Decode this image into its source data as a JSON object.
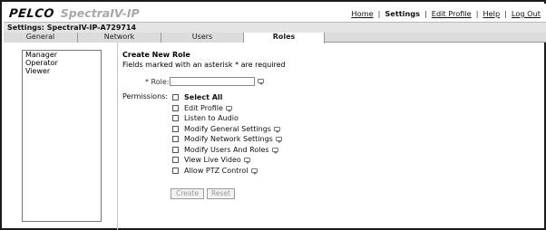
{
  "header": {
    "brand": "PELCO",
    "product": "SpectraIV-IP",
    "nav": [
      {
        "label": "Home",
        "active": false
      },
      {
        "label": "Settings",
        "active": true
      },
      {
        "label": "Edit Profile",
        "active": false
      },
      {
        "label": "Help",
        "active": false
      },
      {
        "label": "Log Out",
        "active": false
      }
    ],
    "separator": "|"
  },
  "settings_bar": {
    "title": "Settings: SpectraIV-IP-A729714"
  },
  "tabs": [
    {
      "label": "General",
      "active": false
    },
    {
      "label": "Network",
      "active": false
    },
    {
      "label": "Users",
      "active": false
    },
    {
      "label": "Roles",
      "active": true
    }
  ],
  "roles_list": [
    "Manager",
    "Operator",
    "Viewer"
  ],
  "form": {
    "title": "Create New Role",
    "required_note": "Fields marked with an asterisk * are required",
    "role_label": "* Role:",
    "role_value": "",
    "permissions_label": "Permissions:",
    "permissions": [
      {
        "label": "Select All",
        "checked": false,
        "bold": true,
        "tooltip": false
      },
      {
        "label": "Edit Profile",
        "checked": false,
        "bold": false,
        "tooltip": true
      },
      {
        "label": "Listen to Audio",
        "checked": false,
        "bold": false,
        "tooltip": false
      },
      {
        "label": "Modify General Settings",
        "checked": false,
        "bold": false,
        "tooltip": true
      },
      {
        "label": "Modify Network Settings",
        "checked": false,
        "bold": false,
        "tooltip": true
      },
      {
        "label": "Modify Users And Roles",
        "checked": false,
        "bold": false,
        "tooltip": true
      },
      {
        "label": "View Live Video",
        "checked": false,
        "bold": false,
        "tooltip": true
      },
      {
        "label": "Allow PTZ Control",
        "checked": false,
        "bold": false,
        "tooltip": true
      }
    ],
    "create_label": "Create",
    "reset_label": "Reset"
  }
}
